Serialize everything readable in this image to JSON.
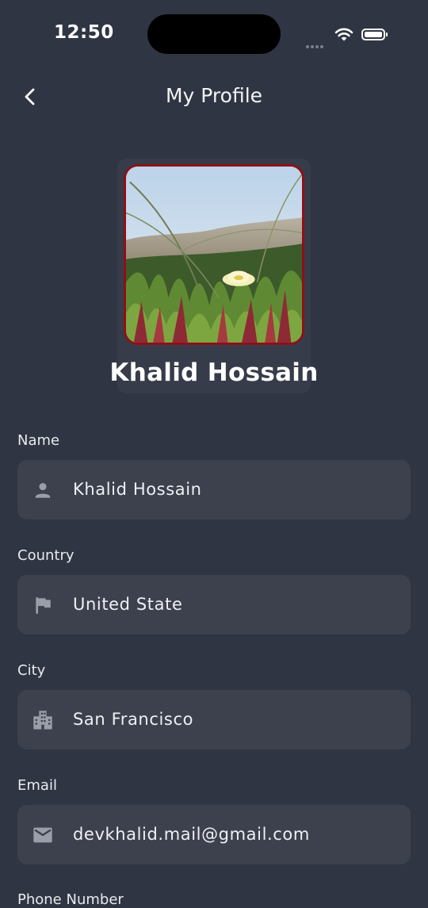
{
  "status_bar": {
    "time": "12:50"
  },
  "header": {
    "title": "My Profile",
    "back_icon": "chevron-left-icon"
  },
  "profile": {
    "name": "Khalid Hossain",
    "avatar": "beach-plant-photo",
    "avatar_border_color": "#8c1118"
  },
  "fields": [
    {
      "label": "Name",
      "value": "Khalid Hossain",
      "icon": "person-icon"
    },
    {
      "label": "Country",
      "value": "United State",
      "icon": "flag-icon"
    },
    {
      "label": "City",
      "value": "San Francisco",
      "icon": "building-icon"
    },
    {
      "label": "Email",
      "value": "devkhalid.mail@gmail.com",
      "icon": "mail-icon"
    },
    {
      "label": "Phone Number"
    }
  ],
  "colors": {
    "background": "#2f3543",
    "field_bg": "#3c414d",
    "icon": "#9a9ea8"
  }
}
